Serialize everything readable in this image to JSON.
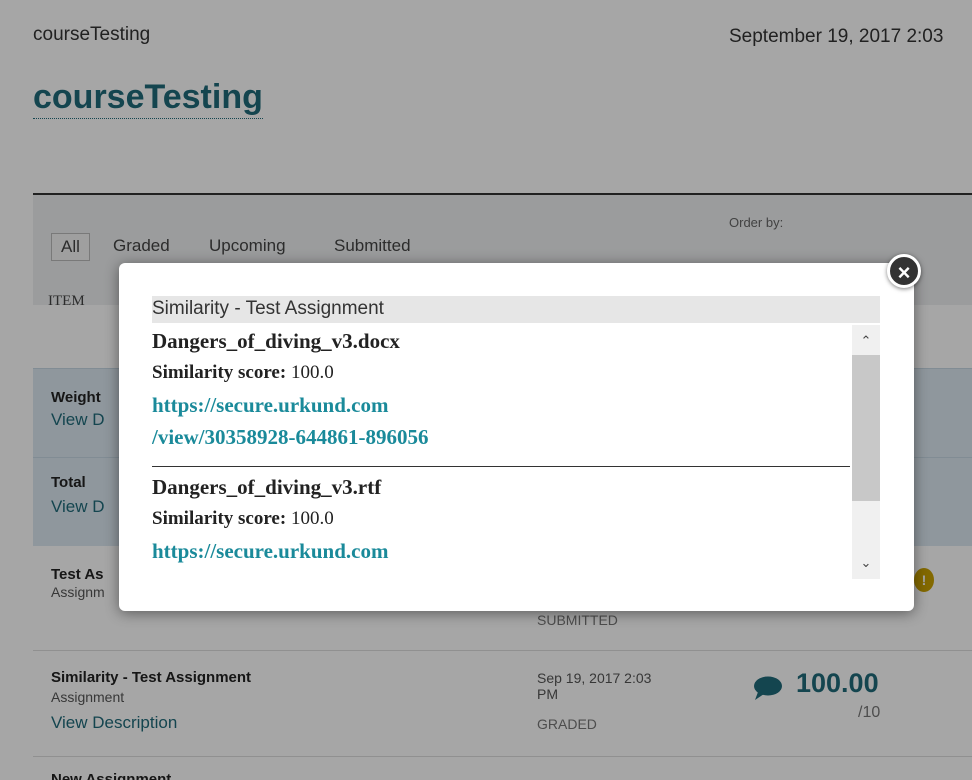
{
  "header": {
    "breadcrumb": "courseTesting",
    "date": "September 19, 2017 2:03",
    "title": "courseTesting"
  },
  "filters": {
    "tabs": [
      "All",
      "Graded",
      "Upcoming",
      "Submitted"
    ],
    "active": "All",
    "order_by_label": "Order by:"
  },
  "table": {
    "item_header": "ITEM",
    "weighted": {
      "label": "Weight",
      "link": "View D"
    },
    "total": {
      "label": "Total",
      "link": "View D"
    },
    "rows": [
      {
        "name": "Test As",
        "type": "Assignm",
        "status": "SUBMITTED"
      },
      {
        "name": "Similarity - Test Assignment",
        "type": "Assignment",
        "link": "View Description",
        "date_line1": "Sep 19, 2017 2:03",
        "date_line2": "PM",
        "status": "GRADED",
        "score": "100.00",
        "out_of": "/10"
      },
      {
        "name": "New Assignment"
      }
    ]
  },
  "modal": {
    "header": "Similarity - Test Assignment",
    "close_icon": "close-icon",
    "entries": [
      {
        "file": "Dangers_of_diving_v3.docx",
        "score_label": "Similarity score:",
        "score": "100.0",
        "url_line1": "https://secure.urkund.com",
        "url_line2": "/view/30358928-644861-896056"
      },
      {
        "file": "Dangers_of_diving_v3.rtf",
        "score_label": "Similarity score:",
        "score": "100.0",
        "url_line1": "https://secure.urkund.com"
      }
    ]
  },
  "colors": {
    "link": "#1f6a7a",
    "modal_link": "#1a8a9a",
    "totals_bg": "#dce9f2"
  }
}
